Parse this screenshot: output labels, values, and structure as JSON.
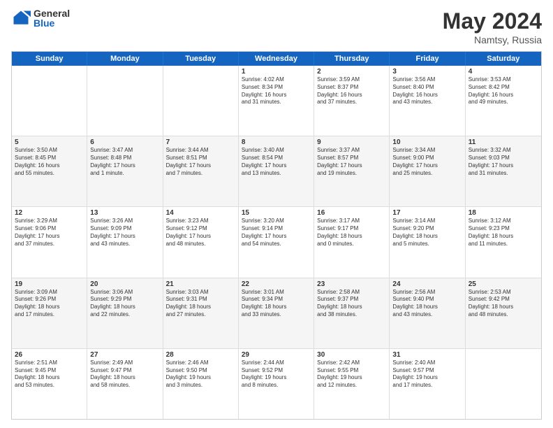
{
  "logo": {
    "general": "General",
    "blue": "Blue"
  },
  "title": "May 2024",
  "subtitle": "Namtsy, Russia",
  "weekdays": [
    "Sunday",
    "Monday",
    "Tuesday",
    "Wednesday",
    "Thursday",
    "Friday",
    "Saturday"
  ],
  "weeks": [
    [
      {
        "day": "",
        "info": ""
      },
      {
        "day": "",
        "info": ""
      },
      {
        "day": "",
        "info": ""
      },
      {
        "day": "1",
        "info": "Sunrise: 4:02 AM\nSunset: 8:34 PM\nDaylight: 16 hours\nand 31 minutes."
      },
      {
        "day": "2",
        "info": "Sunrise: 3:59 AM\nSunset: 8:37 PM\nDaylight: 16 hours\nand 37 minutes."
      },
      {
        "day": "3",
        "info": "Sunrise: 3:56 AM\nSunset: 8:40 PM\nDaylight: 16 hours\nand 43 minutes."
      },
      {
        "day": "4",
        "info": "Sunrise: 3:53 AM\nSunset: 8:42 PM\nDaylight: 16 hours\nand 49 minutes."
      }
    ],
    [
      {
        "day": "5",
        "info": "Sunrise: 3:50 AM\nSunset: 8:45 PM\nDaylight: 16 hours\nand 55 minutes."
      },
      {
        "day": "6",
        "info": "Sunrise: 3:47 AM\nSunset: 8:48 PM\nDaylight: 17 hours\nand 1 minute."
      },
      {
        "day": "7",
        "info": "Sunrise: 3:44 AM\nSunset: 8:51 PM\nDaylight: 17 hours\nand 7 minutes."
      },
      {
        "day": "8",
        "info": "Sunrise: 3:40 AM\nSunset: 8:54 PM\nDaylight: 17 hours\nand 13 minutes."
      },
      {
        "day": "9",
        "info": "Sunrise: 3:37 AM\nSunset: 8:57 PM\nDaylight: 17 hours\nand 19 minutes."
      },
      {
        "day": "10",
        "info": "Sunrise: 3:34 AM\nSunset: 9:00 PM\nDaylight: 17 hours\nand 25 minutes."
      },
      {
        "day": "11",
        "info": "Sunrise: 3:32 AM\nSunset: 9:03 PM\nDaylight: 17 hours\nand 31 minutes."
      }
    ],
    [
      {
        "day": "12",
        "info": "Sunrise: 3:29 AM\nSunset: 9:06 PM\nDaylight: 17 hours\nand 37 minutes."
      },
      {
        "day": "13",
        "info": "Sunrise: 3:26 AM\nSunset: 9:09 PM\nDaylight: 17 hours\nand 43 minutes."
      },
      {
        "day": "14",
        "info": "Sunrise: 3:23 AM\nSunset: 9:12 PM\nDaylight: 17 hours\nand 48 minutes."
      },
      {
        "day": "15",
        "info": "Sunrise: 3:20 AM\nSunset: 9:14 PM\nDaylight: 17 hours\nand 54 minutes."
      },
      {
        "day": "16",
        "info": "Sunrise: 3:17 AM\nSunset: 9:17 PM\nDaylight: 18 hours\nand 0 minutes."
      },
      {
        "day": "17",
        "info": "Sunrise: 3:14 AM\nSunset: 9:20 PM\nDaylight: 18 hours\nand 5 minutes."
      },
      {
        "day": "18",
        "info": "Sunrise: 3:12 AM\nSunset: 9:23 PM\nDaylight: 18 hours\nand 11 minutes."
      }
    ],
    [
      {
        "day": "19",
        "info": "Sunrise: 3:09 AM\nSunset: 9:26 PM\nDaylight: 18 hours\nand 17 minutes."
      },
      {
        "day": "20",
        "info": "Sunrise: 3:06 AM\nSunset: 9:29 PM\nDaylight: 18 hours\nand 22 minutes."
      },
      {
        "day": "21",
        "info": "Sunrise: 3:03 AM\nSunset: 9:31 PM\nDaylight: 18 hours\nand 27 minutes."
      },
      {
        "day": "22",
        "info": "Sunrise: 3:01 AM\nSunset: 9:34 PM\nDaylight: 18 hours\nand 33 minutes."
      },
      {
        "day": "23",
        "info": "Sunrise: 2:58 AM\nSunset: 9:37 PM\nDaylight: 18 hours\nand 38 minutes."
      },
      {
        "day": "24",
        "info": "Sunrise: 2:56 AM\nSunset: 9:40 PM\nDaylight: 18 hours\nand 43 minutes."
      },
      {
        "day": "25",
        "info": "Sunrise: 2:53 AM\nSunset: 9:42 PM\nDaylight: 18 hours\nand 48 minutes."
      }
    ],
    [
      {
        "day": "26",
        "info": "Sunrise: 2:51 AM\nSunset: 9:45 PM\nDaylight: 18 hours\nand 53 minutes."
      },
      {
        "day": "27",
        "info": "Sunrise: 2:49 AM\nSunset: 9:47 PM\nDaylight: 18 hours\nand 58 minutes."
      },
      {
        "day": "28",
        "info": "Sunrise: 2:46 AM\nSunset: 9:50 PM\nDaylight: 19 hours\nand 3 minutes."
      },
      {
        "day": "29",
        "info": "Sunrise: 2:44 AM\nSunset: 9:52 PM\nDaylight: 19 hours\nand 8 minutes."
      },
      {
        "day": "30",
        "info": "Sunrise: 2:42 AM\nSunset: 9:55 PM\nDaylight: 19 hours\nand 12 minutes."
      },
      {
        "day": "31",
        "info": "Sunrise: 2:40 AM\nSunset: 9:57 PM\nDaylight: 19 hours\nand 17 minutes."
      },
      {
        "day": "",
        "info": ""
      }
    ]
  ]
}
